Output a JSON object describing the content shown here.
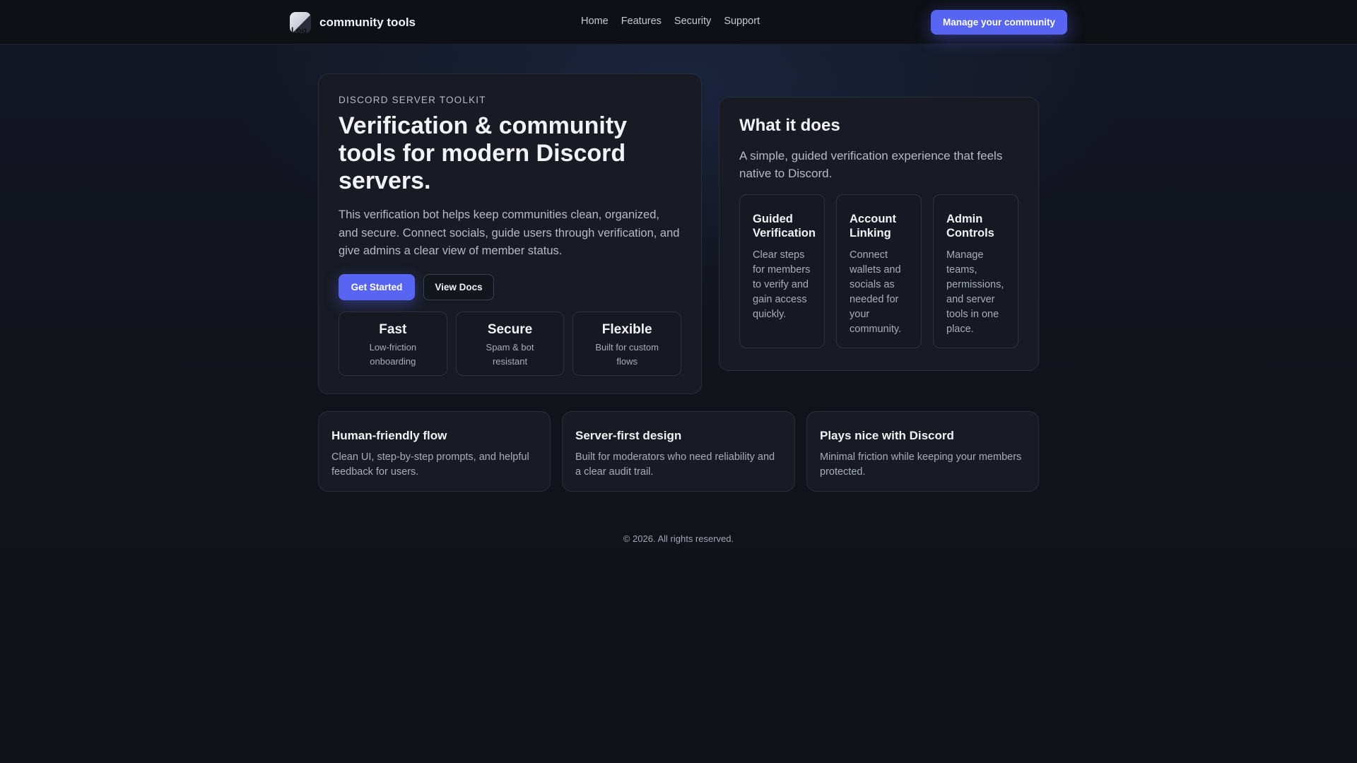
{
  "header": {
    "logo_alt": "Log",
    "brand": "community tools",
    "nav": [
      "Home",
      "Features",
      "Security",
      "Support"
    ],
    "cta": "Manage your community"
  },
  "hero": {
    "eyebrow": "DISCORD SERVER TOOLKIT",
    "title": "Verification & community tools for modern Discord servers.",
    "description": "This verification bot helps keep communities clean, organized, and secure. Connect socials, guide users through verification, and give admins a clear view of member status.",
    "primary_button": "Get Started",
    "secondary_button": "View Docs",
    "stats": [
      {
        "title": "Fast",
        "subtitle": "Low-friction onboarding"
      },
      {
        "title": "Secure",
        "subtitle": "Spam & bot resistant"
      },
      {
        "title": "Flexible",
        "subtitle": "Built for custom flows"
      }
    ]
  },
  "what_it_does": {
    "title": "What it does",
    "description": "A simple, guided verification experience that feels native to Discord.",
    "features": [
      {
        "title": "Guided Verification",
        "description": "Clear steps for members to verify and gain access quickly."
      },
      {
        "title": "Account Linking",
        "description": "Connect wallets and socials as needed for your community."
      },
      {
        "title": "Admin Controls",
        "description": "Manage teams, permissions, and server tools in one place."
      }
    ]
  },
  "highlights": [
    {
      "title": "Human-friendly flow",
      "description": "Clean UI, step-by-step prompts, and helpful feedback for users."
    },
    {
      "title": "Server-first design",
      "description": "Built for moderators who need reliability and a clear audit trail."
    },
    {
      "title": "Plays nice with Discord",
      "description": "Minimal friction while keeping your members protected."
    }
  ],
  "footer": {
    "copyright": "© 2026. All rights reserved."
  },
  "colors": {
    "accent": "#5865f2",
    "background": "#11131a",
    "card": "#181b24",
    "border": "#2a2e3a"
  }
}
